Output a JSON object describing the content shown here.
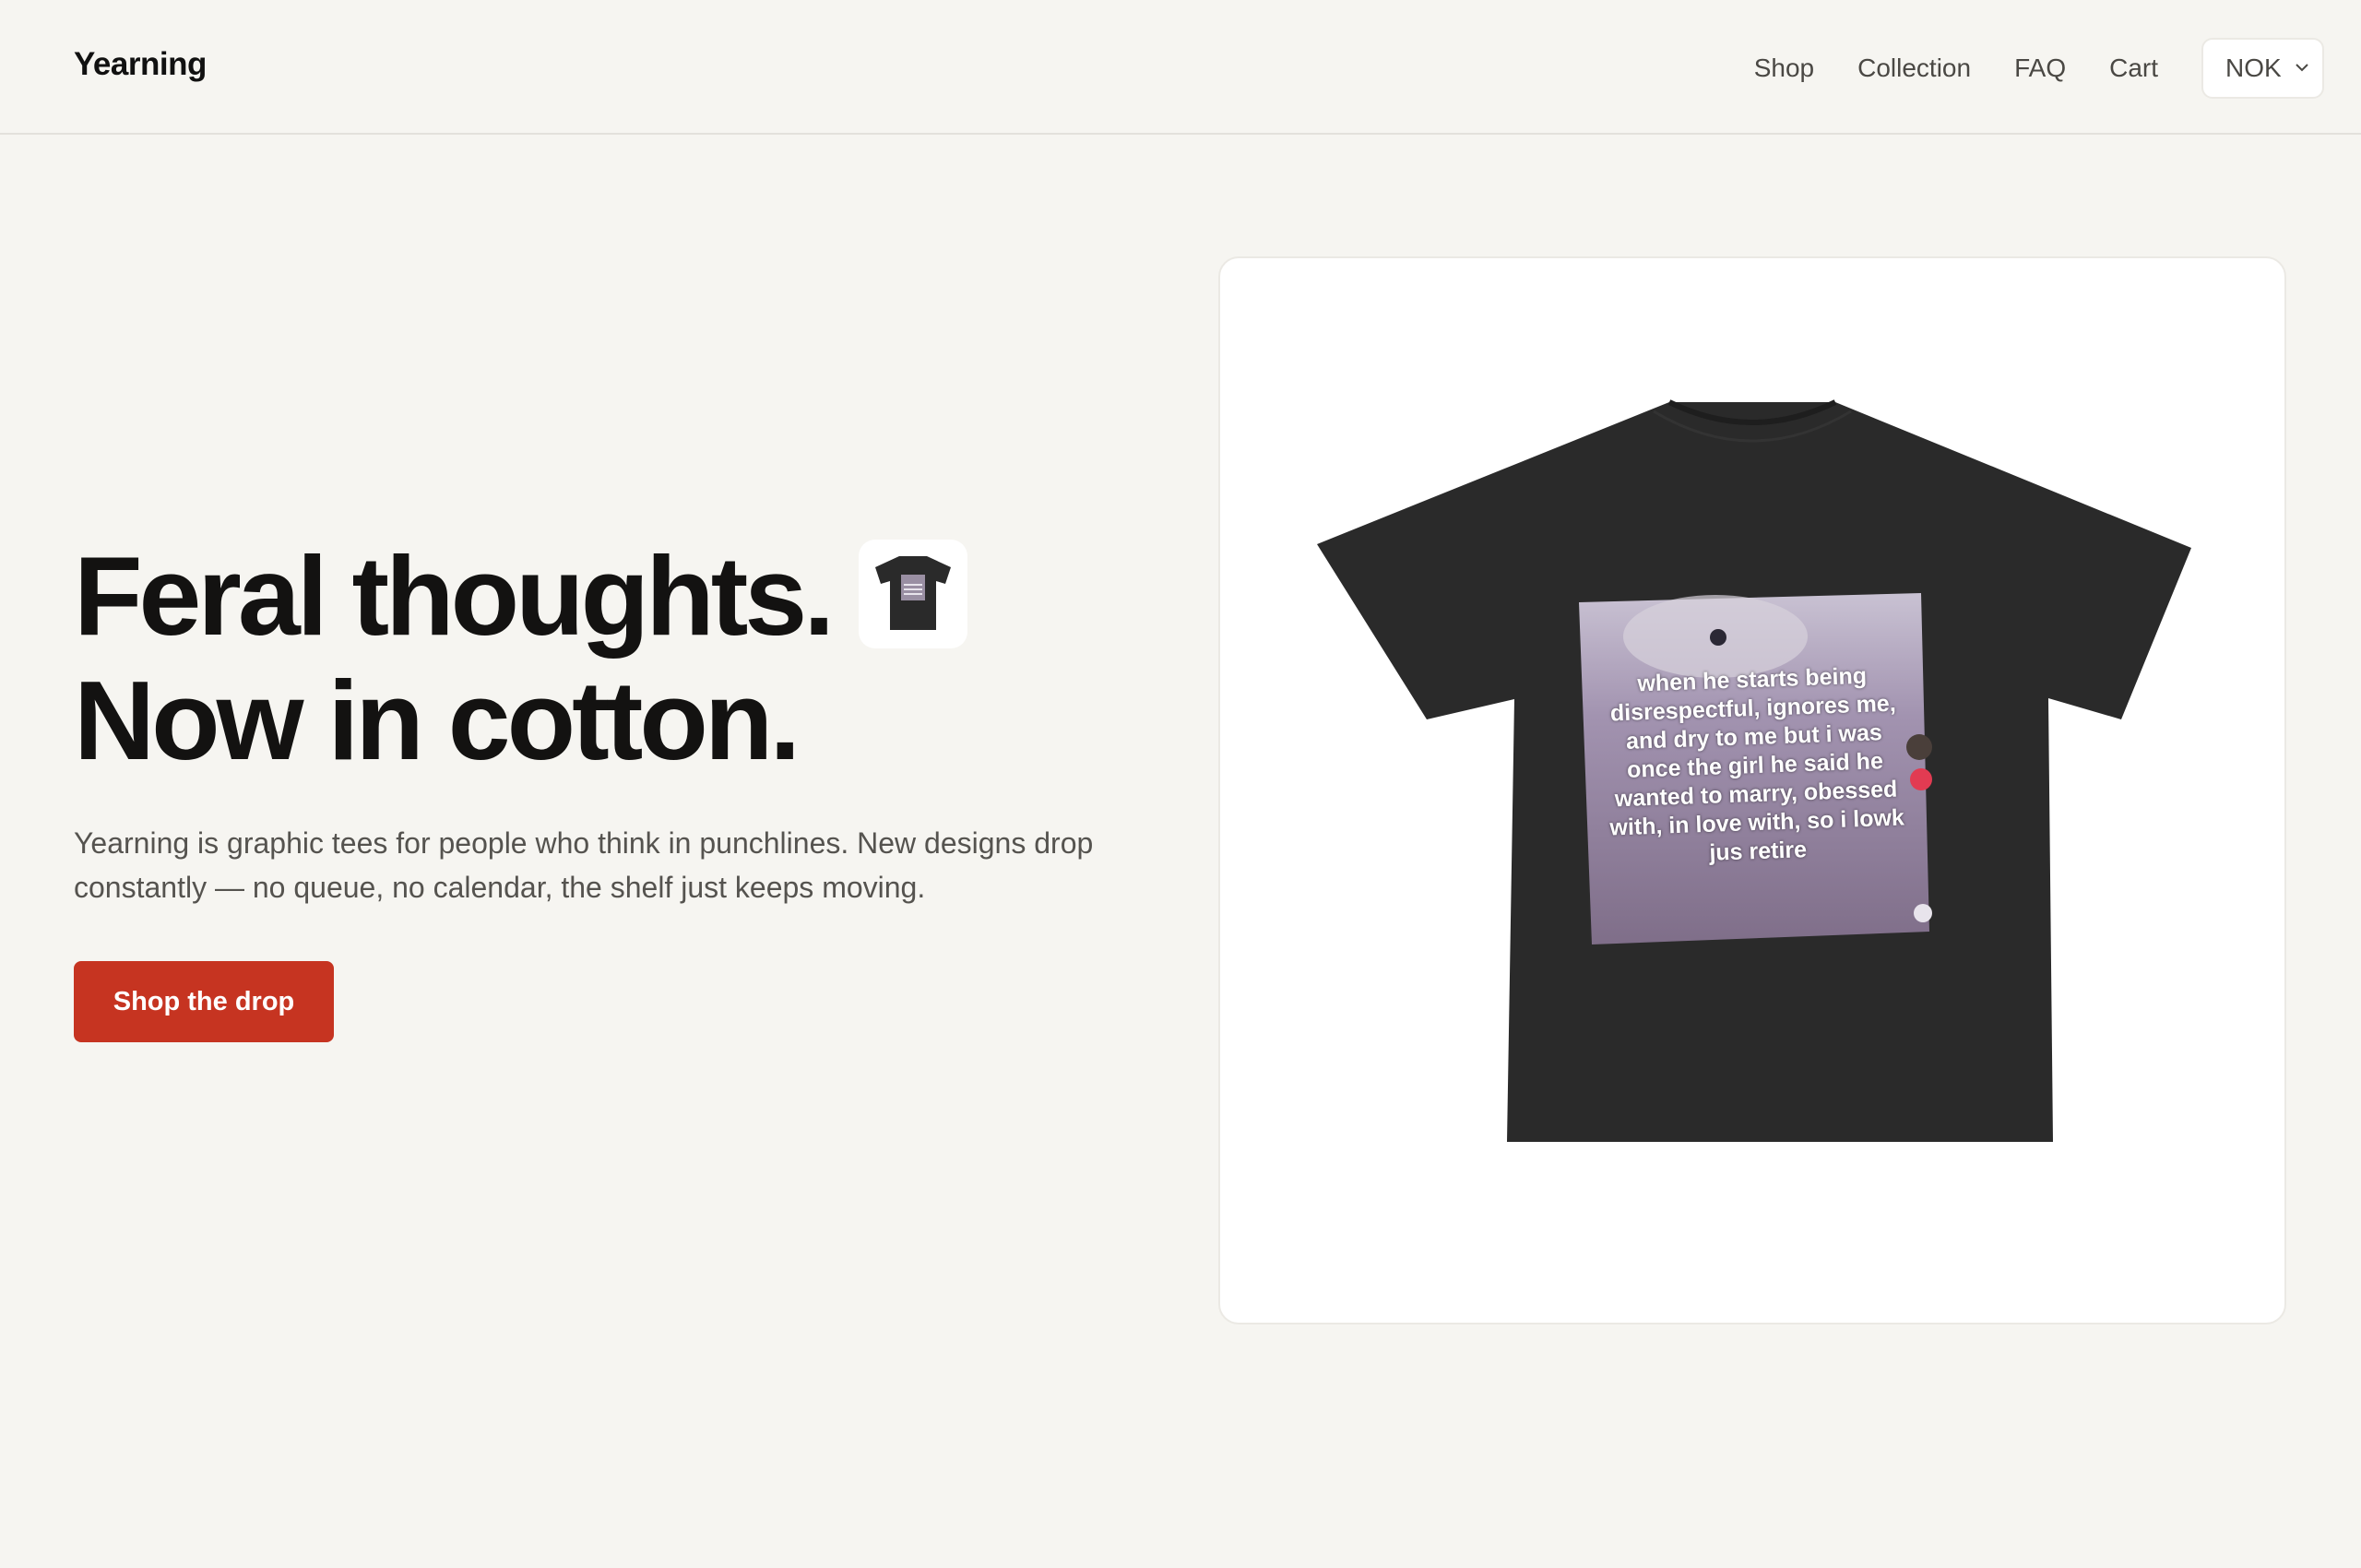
{
  "brand": {
    "name": "Yearning"
  },
  "nav": {
    "items": [
      {
        "label": "Shop"
      },
      {
        "label": "Collection"
      },
      {
        "label": "FAQ"
      },
      {
        "label": "Cart"
      }
    ],
    "currency": {
      "selected": "NOK"
    }
  },
  "hero": {
    "title_line1": "Feral thoughts.",
    "title_line2": "Now in cotton.",
    "description": "Yearning is graphic tees for people who think in punchlines. New designs drop constantly — no queue, no calendar, the shelf just keeps moving.",
    "cta_label": "Shop the drop"
  },
  "product": {
    "print_text": "when he starts being disrespectful, ignores me, and dry to me but i was once the girl he said he wanted to marry, obessed with, in love with, so i lowk jus retire",
    "shirt_color": "#2a2a2a"
  },
  "colors": {
    "accent": "#c63421",
    "background": "#f6f5f1"
  }
}
